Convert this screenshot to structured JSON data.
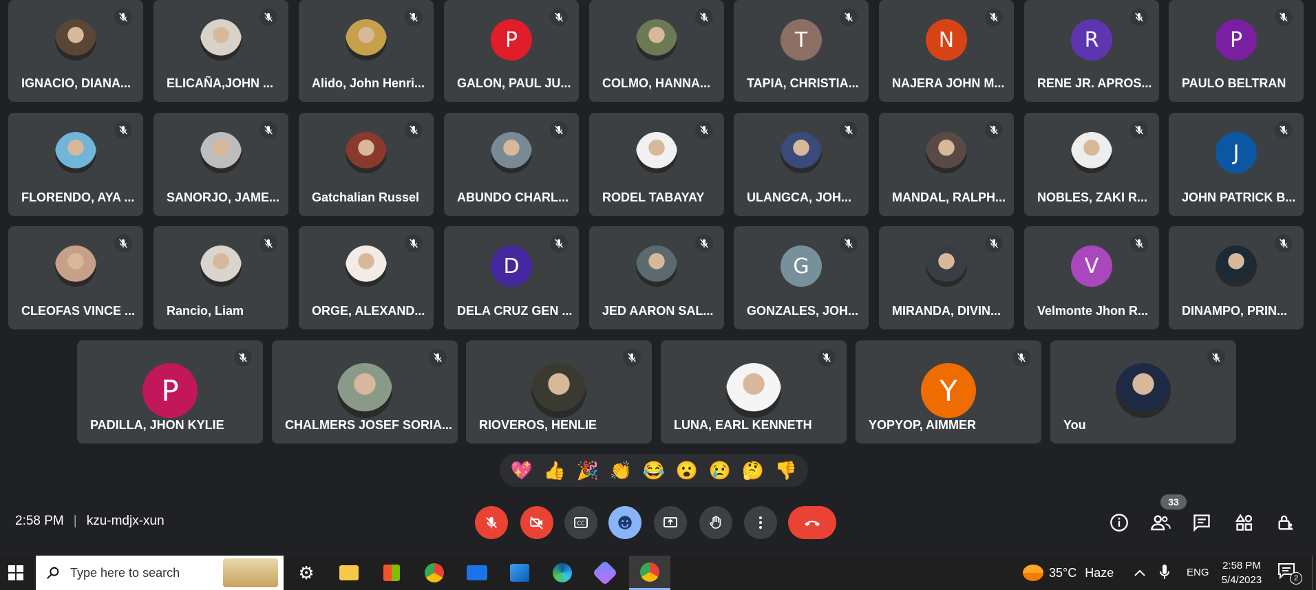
{
  "participants_row1": [
    {
      "name": "IGNACIO, DIANA...",
      "avatar": "photo",
      "color": "#5a4634"
    },
    {
      "name": "ELICAÑA,JOHN ...",
      "avatar": "photo",
      "color": "#d9d2c8"
    },
    {
      "name": "Alido, John Henri...",
      "avatar": "photo",
      "color": "#c6a14a"
    },
    {
      "name": "GALON, PAUL JU...",
      "avatar": "P",
      "color": "#e11d2a"
    },
    {
      "name": "COLMO, HANNA...",
      "avatar": "photo",
      "color": "#6b7a55"
    },
    {
      "name": "TAPIA, CHRISTIA...",
      "avatar": "T",
      "color": "#8d6e63"
    },
    {
      "name": "NAJERA JOHN M...",
      "avatar": "N",
      "color": "#d84315"
    },
    {
      "name": "RENE JR. APROS...",
      "avatar": "R",
      "color": "#5e35b1"
    },
    {
      "name": "PAULO BELTRAN",
      "avatar": "P",
      "color": "#7b1fa2"
    }
  ],
  "participants_row2": [
    {
      "name": "FLORENDO, AYA ...",
      "avatar": "photo",
      "color": "#6fb6d9"
    },
    {
      "name": "SANORJO, JAME...",
      "avatar": "photo",
      "color": "#bdbdbd"
    },
    {
      "name": "Gatchalian Russel",
      "avatar": "photo",
      "color": "#8a3a2a"
    },
    {
      "name": "ABUNDO CHARL...",
      "avatar": "photo",
      "color": "#7a8a95"
    },
    {
      "name": "RODEL TABAYAY",
      "avatar": "photo",
      "color": "#f1f1f1"
    },
    {
      "name": "ULANGCA, JOH...",
      "avatar": "photo",
      "color": "#3a4a7a"
    },
    {
      "name": "MANDAL, RALPH...",
      "avatar": "photo",
      "color": "#5a4a44"
    },
    {
      "name": "NOBLES, ZAKI R...",
      "avatar": "photo",
      "color": "#eeeeee"
    },
    {
      "name": "JOHN PATRICK B...",
      "avatar": "J",
      "color": "#0b57a4"
    }
  ],
  "participants_row3": [
    {
      "name": "CLEOFAS VINCE ...",
      "avatar": "photo",
      "color": "#c7a08a"
    },
    {
      "name": "Rancio, Liam",
      "avatar": "photo",
      "color": "#d9d4cc"
    },
    {
      "name": "ORGE, ALEXAND...",
      "avatar": "photo",
      "color": "#f3ece6"
    },
    {
      "name": "DELA CRUZ GEN ...",
      "avatar": "D",
      "color": "#4527a0"
    },
    {
      "name": "JED AARON SAL...",
      "avatar": "photo",
      "color": "#5a6a6e"
    },
    {
      "name": "GONZALES, JOH...",
      "avatar": "G",
      "color": "#78909c"
    },
    {
      "name": "MIRANDA, DIVIN...",
      "avatar": "photo",
      "color": "#3a3d44"
    },
    {
      "name": "Velmonte Jhon R...",
      "avatar": "V",
      "color": "#ab47bc"
    },
    {
      "name": "DINAMPO, PRIN...",
      "avatar": "photo",
      "color": "#1c2a35"
    }
  ],
  "participants_row4": [
    {
      "name": "PADILLA, JHON KYLIE",
      "avatar": "P",
      "color": "#c2185b"
    },
    {
      "name": "CHALMERS JOSEF SORIA...",
      "avatar": "photo",
      "color": "#8a9a88"
    },
    {
      "name": "RIOVEROS, HENLIE",
      "avatar": "photo",
      "color": "#3b3a30"
    },
    {
      "name": "LUNA, EARL KENNETH",
      "avatar": "photo",
      "color": "#f5f5f5"
    },
    {
      "name": "YOPYOP, AIMMER",
      "avatar": "Y",
      "color": "#ef6c00"
    },
    {
      "name": "You",
      "avatar": "photo",
      "color": "#1e2a44"
    }
  ],
  "reactions": [
    "💖",
    "👍",
    "🎉",
    "👏",
    "😂",
    "😮",
    "😢",
    "🤔",
    "👎"
  ],
  "meeting": {
    "time": "2:58 PM",
    "separator": "|",
    "code": "kzu-mdjx-xun"
  },
  "people_count": "33",
  "taskbar": {
    "search_placeholder": "Type here to search",
    "weather_temp": "35°C",
    "weather_desc": "Haze",
    "lang": "ENG",
    "clock_time": "2:58 PM",
    "clock_date": "5/4/2023",
    "notif_count": "2"
  },
  "colors": {
    "bg": "#202124",
    "tile": "#3c4043",
    "end_call": "#ea4335",
    "active": "#8ab4f8"
  }
}
